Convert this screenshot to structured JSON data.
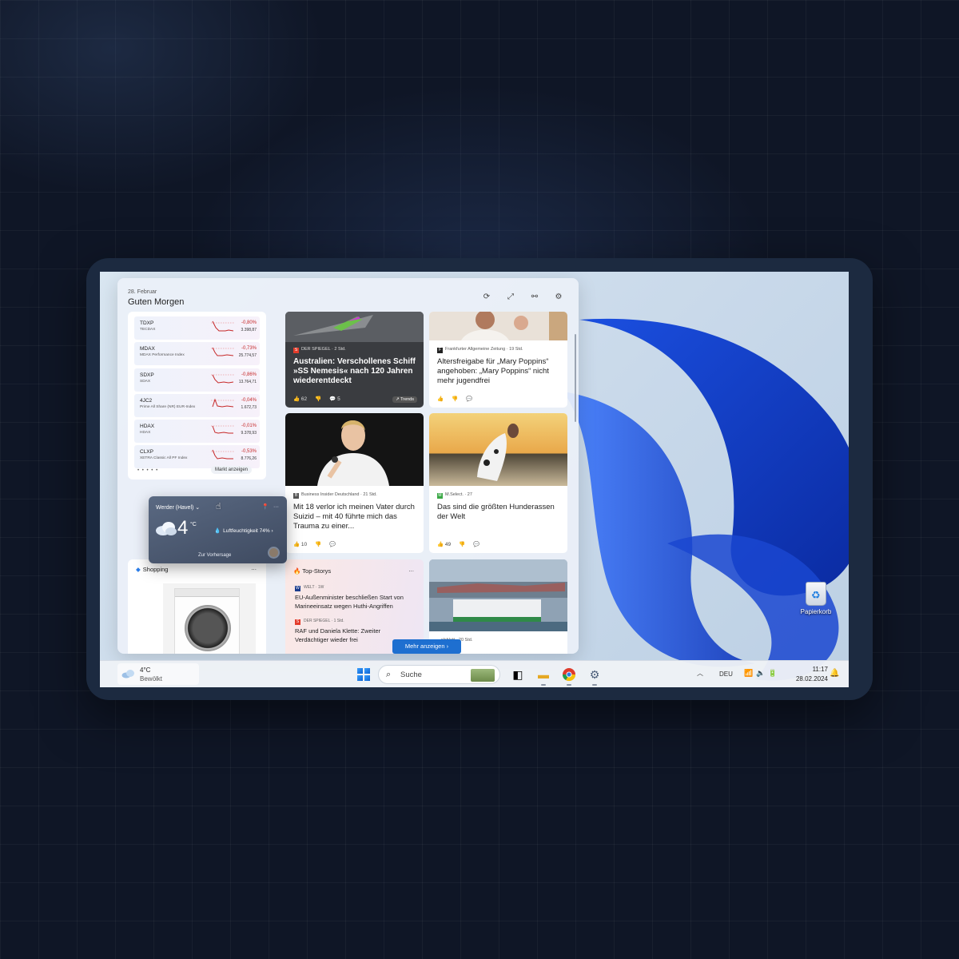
{
  "board": {
    "date": "28. Februar",
    "greeting": "Guten Morgen",
    "tool_icons": [
      "refresh-icon",
      "expand-icon",
      "link-icon",
      "settings-icon"
    ]
  },
  "stocks": {
    "rows": [
      {
        "symbol": "TDXP",
        "name": "TECDAX",
        "change": "-0,80%",
        "price": "3.398,87"
      },
      {
        "symbol": "MDAX",
        "name": "MDAX Performance Index",
        "change": "-0,73%",
        "price": "25.774,57"
      },
      {
        "symbol": "SDXP",
        "name": "SDAX",
        "change": "-0,86%",
        "price": "13.764,71"
      },
      {
        "symbol": "4JC2",
        "name": "Prime All Share (NR) EUR-Index",
        "change": "-0,04%",
        "price": "1.672,73"
      },
      {
        "symbol": "HDAX",
        "name": "HDAX",
        "change": "-0,01%",
        "price": "9.378,93"
      },
      {
        "symbol": "CLXP",
        "name": "XETRA Classic All PF Index",
        "change": "-0,53%",
        "price": "8.776,26"
      }
    ],
    "more_label": "Markt anzeigen",
    "pager": "• • • • •"
  },
  "weather": {
    "location": "Werder (Havel)",
    "temperature": "4",
    "unit": "°C",
    "humidity": "Luftfeuchtigkeit 74%",
    "forecast_label": "Zur Vorhersage"
  },
  "shopping": {
    "title": "Shopping",
    "more": "..."
  },
  "news": [
    {
      "source": "DER SPIEGEL · 2 Std.",
      "title": "Australien: Verschollenes Schiff »SS Nemesis« nach 120 Jahren wiederentdeckt",
      "likes": "62",
      "comments": "5",
      "trend": "Trends"
    },
    {
      "source": "Frankfurter Allgemeine Zeitung · 19 Std.",
      "title": "Altersfreigabe für „Mary Poppins“ angehoben: „Mary Poppins“ nicht mehr jugendfrei"
    },
    {
      "source": "Business Insider Deutschland · 21 Std.",
      "title": "Mit 18 verlor ich meinen Vater durch Suizid – mit 40 führte mich das Trauma zu einer...",
      "likes": "10"
    },
    {
      "source": "M.Select. · 27",
      "title": "Das sind die größten Hunderassen der Welt",
      "likes": "49"
    },
    {
      "source": "...elsblatt · 20 Std.",
      "title": ""
    }
  ],
  "top_stories": {
    "title": "Top-Storys",
    "more": "...",
    "items": [
      {
        "source": "WELT · 1W",
        "title": "EU-Außenminister beschließen Start von Marineeinsatz wegen Huthi-Angriffen"
      },
      {
        "source": "DER SPIEGEL · 1 Std.",
        "title": "RAF und Daniela Klette: Zweiter Verdächtiger wieder frei"
      }
    ]
  },
  "mehr_label": "Mehr anzeigen",
  "desktop": {
    "recycle_bin": "Papierkorb"
  },
  "taskbar": {
    "weather_temp": "4°C",
    "weather_desc": "Bewölkt",
    "search_placeholder": "Suche",
    "language": "DEU",
    "time": "11:17",
    "date": "28.02.2024"
  },
  "colors": {
    "accent": "#1e6fd0",
    "negative": "#c62828",
    "background": "#0f1626",
    "device_frame": "#1c2a40"
  }
}
